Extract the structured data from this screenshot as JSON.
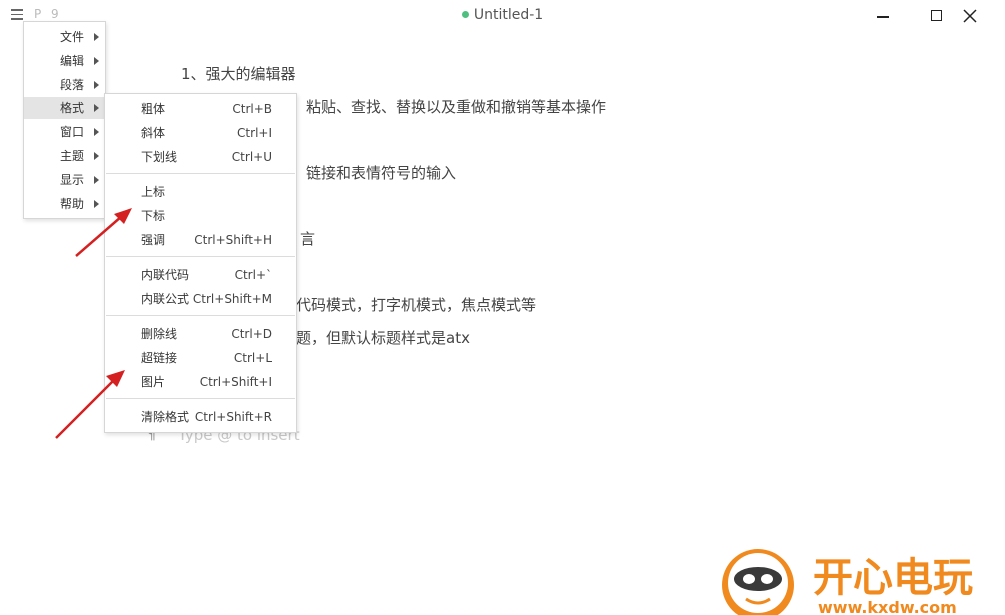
{
  "titlebar": {
    "page_indicator": "P 9",
    "document_title": "Untitled-1"
  },
  "editor": {
    "lines": [
      "1、强大的编辑器",
      "粘贴、查找、替换以及重做和撤销等基本操作",
      "链接和表情符号的输入",
      "言",
      "代码模式，打字机模式，焦点模式等",
      "题，但默认标题样式是atx"
    ],
    "placeholder": "Type @ to insert",
    "paragraph_mark": "¶"
  },
  "main_menu": {
    "items": [
      {
        "label": "文件"
      },
      {
        "label": "编辑"
      },
      {
        "label": "段落"
      },
      {
        "label": "格式"
      },
      {
        "label": "窗口"
      },
      {
        "label": "主题"
      },
      {
        "label": "显示"
      },
      {
        "label": "帮助"
      }
    ]
  },
  "format_menu": {
    "items": [
      {
        "label": "粗体",
        "shortcut": "Ctrl+B"
      },
      {
        "label": "斜体",
        "shortcut": "Ctrl+I"
      },
      {
        "label": "下划线",
        "shortcut": "Ctrl+U"
      },
      {
        "label": "上标",
        "shortcut": ""
      },
      {
        "label": "下标",
        "shortcut": ""
      },
      {
        "label": "强调",
        "shortcut": "Ctrl+Shift+H"
      },
      {
        "label": "内联代码",
        "shortcut": "Ctrl+`"
      },
      {
        "label": "内联公式",
        "shortcut": "Ctrl+Shift+M"
      },
      {
        "label": "删除线",
        "shortcut": "Ctrl+D"
      },
      {
        "label": "超链接",
        "shortcut": "Ctrl+L"
      },
      {
        "label": "图片",
        "shortcut": "Ctrl+Shift+I"
      },
      {
        "label": "清除格式",
        "shortcut": "Ctrl+Shift+R"
      }
    ]
  },
  "watermark": {
    "text": "开心电玩",
    "url": "www.kxdw.com"
  },
  "colors": {
    "status_dot": "#4fbf7f",
    "annotation_arrow": "#d42020",
    "active_menu_bg": "#e4e4e4"
  }
}
